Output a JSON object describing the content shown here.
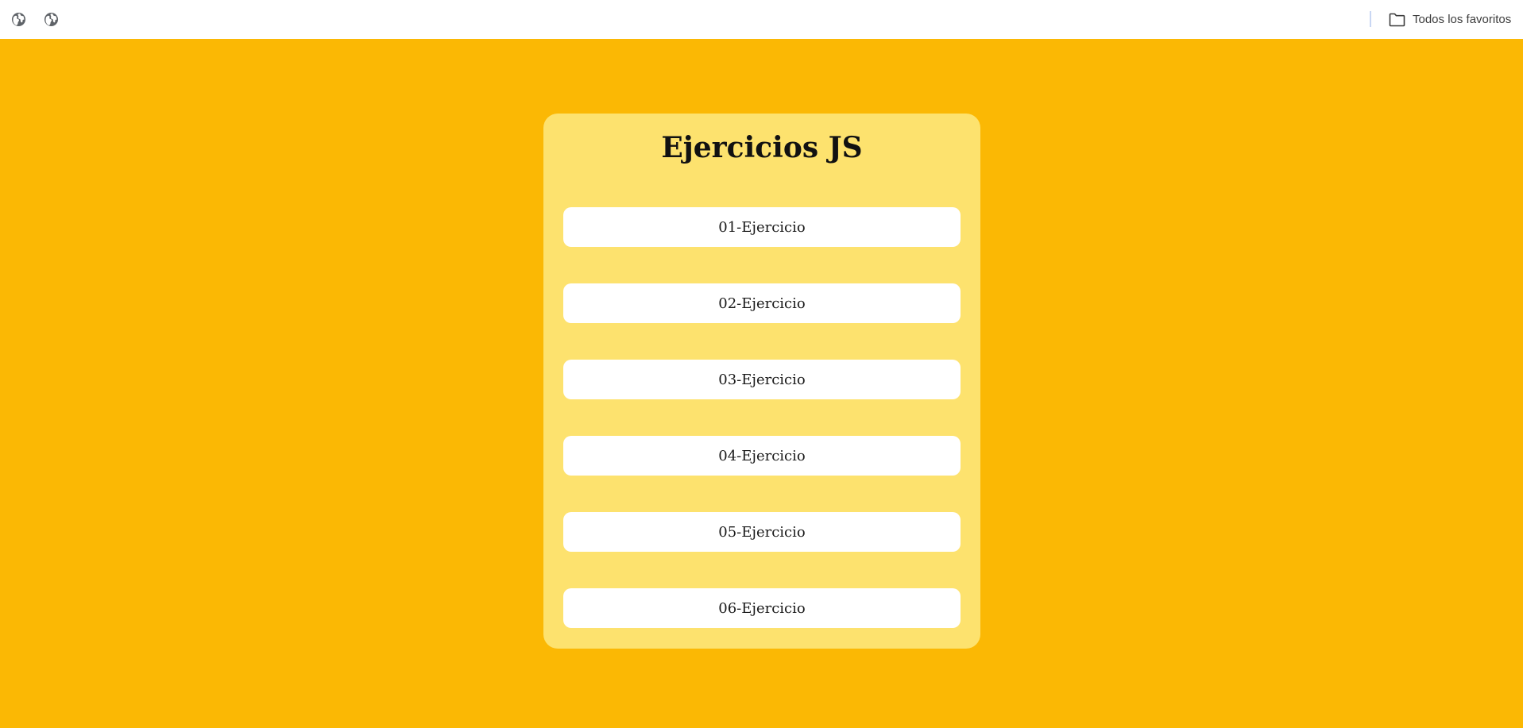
{
  "bookmarks_bar": {
    "items": [
      {
        "icon": "globe-icon"
      },
      {
        "icon": "globe-icon"
      }
    ],
    "all_bookmarks_label": "Todos los favoritos",
    "all_bookmarks_icon": "folder-icon"
  },
  "page": {
    "background_color": "#fbb804",
    "card_color": "#fde26e",
    "title": "Ejercicios JS",
    "exercises": [
      {
        "label": "01-Ejercicio"
      },
      {
        "label": "02-Ejercicio"
      },
      {
        "label": "03-Ejercicio"
      },
      {
        "label": "04-Ejercicio"
      },
      {
        "label": "05-Ejercicio"
      },
      {
        "label": "06-Ejercicio"
      }
    ]
  }
}
